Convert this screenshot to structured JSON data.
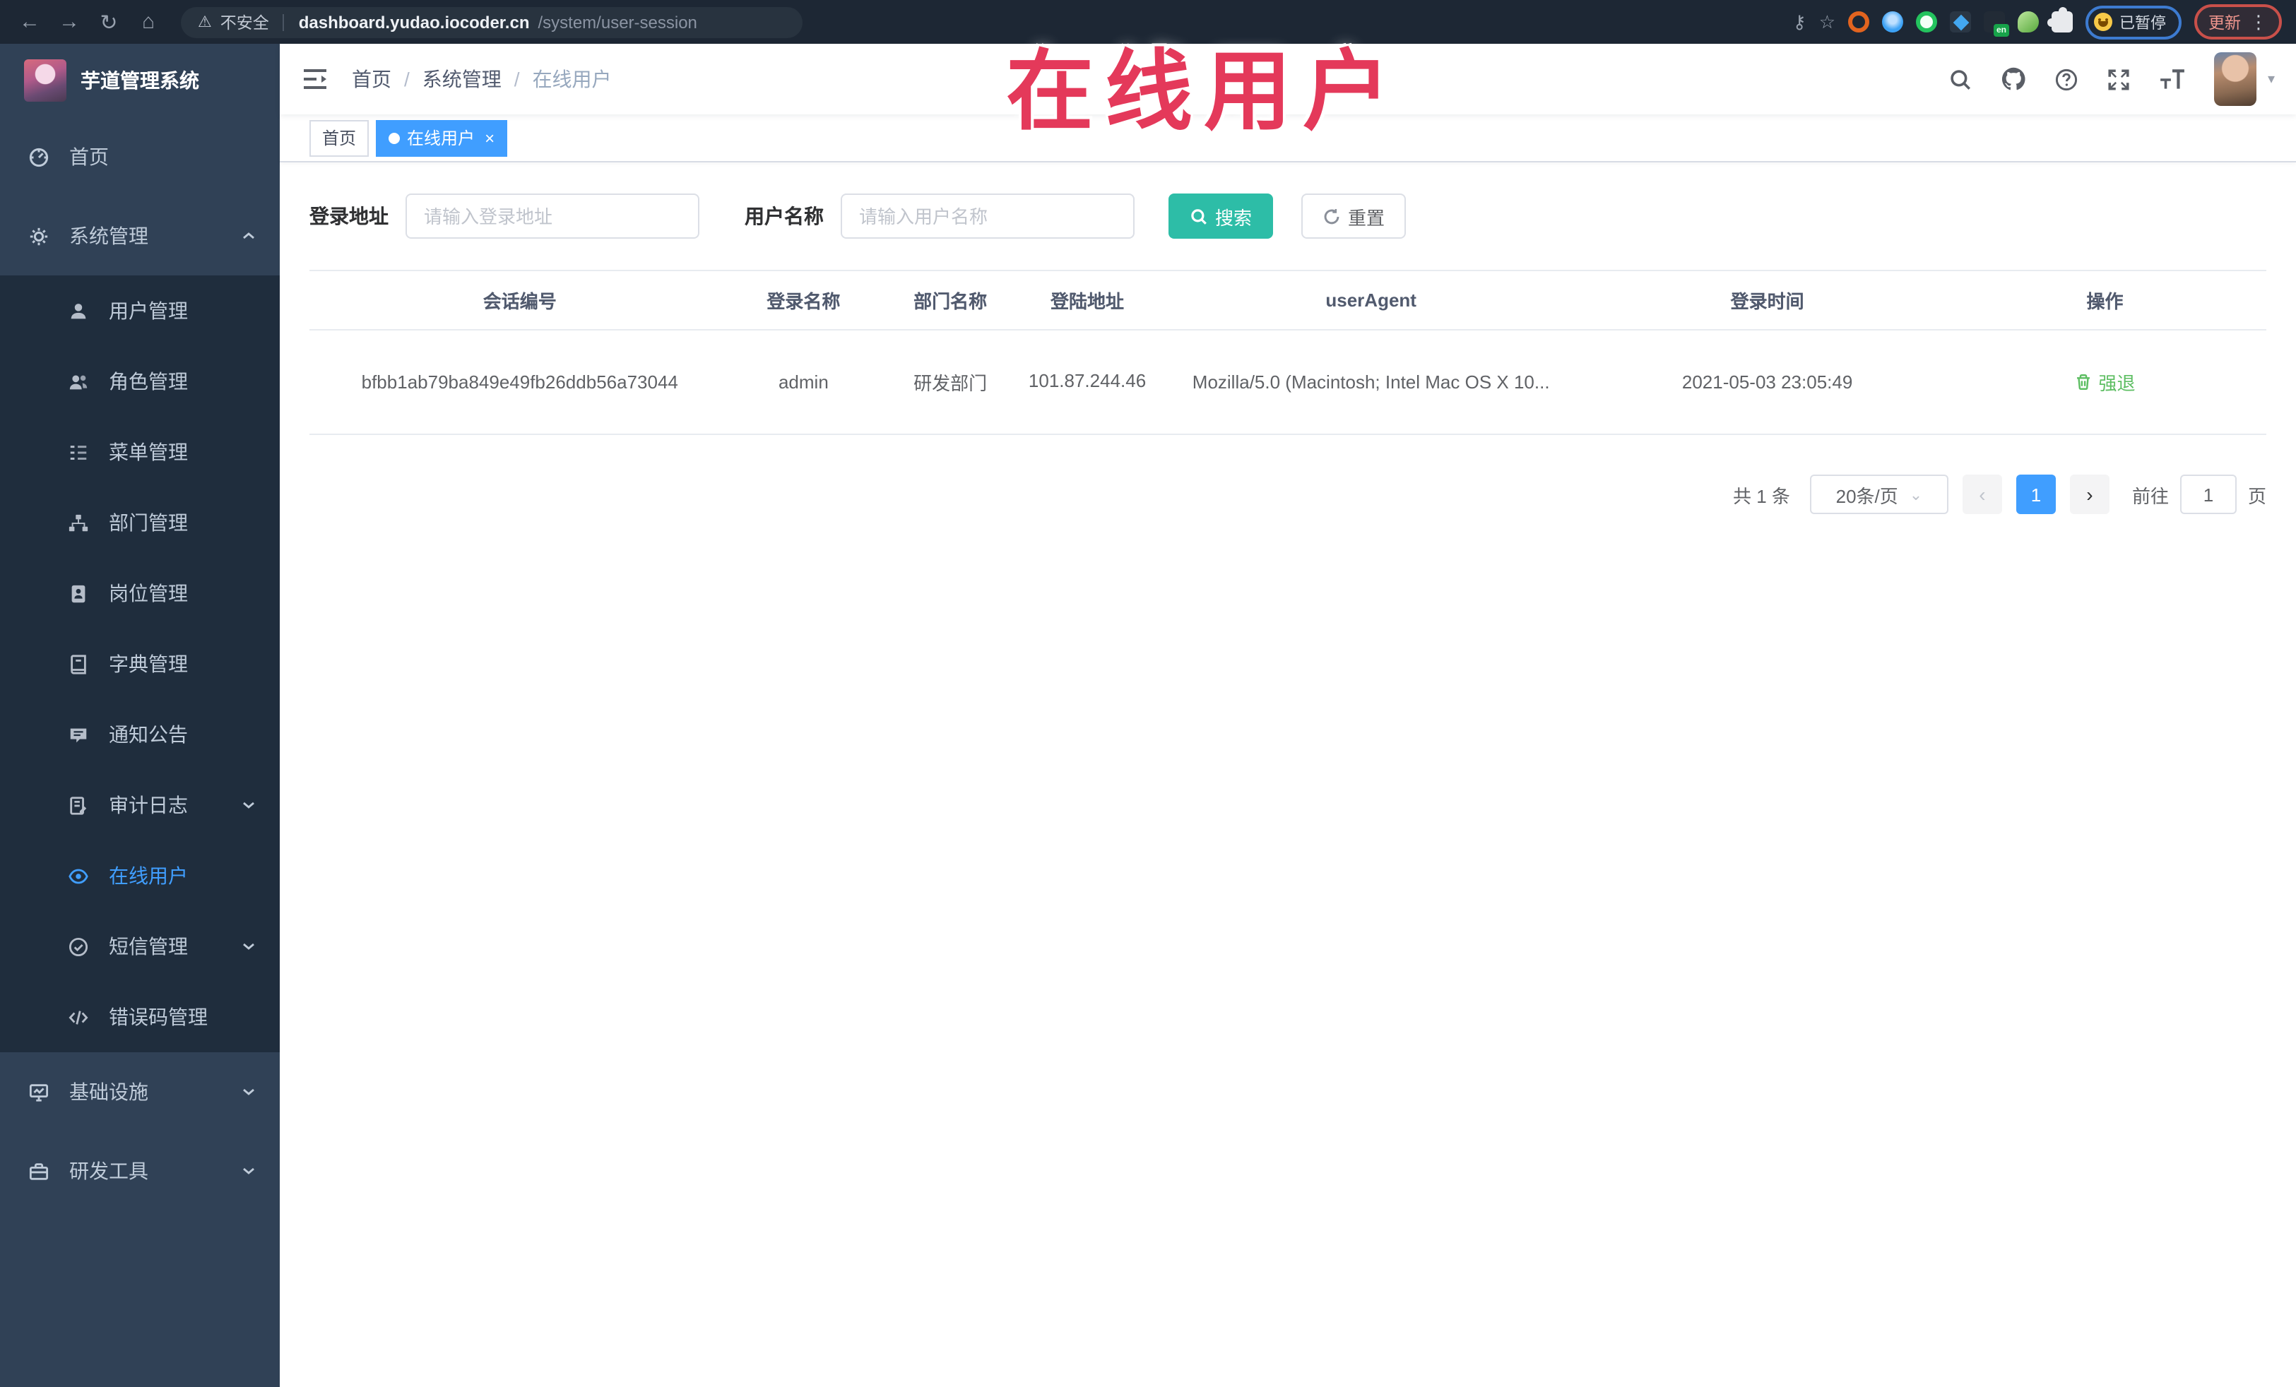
{
  "icons": {
    "back": "←",
    "forward": "→",
    "reload": "↻",
    "home": "⌂",
    "warning": "⚠",
    "key": "⚷",
    "star": "☆",
    "kebab": "⋮",
    "caret_down": "▾",
    "select_caret": "⌄",
    "prev": "‹",
    "next": "›",
    "tab_close": "×"
  },
  "browser": {
    "security_label": "不安全",
    "url_host": "dashboard.yudao.iocoder.cn",
    "url_path": "/system/user-session",
    "en_badge": "en",
    "paused_label": "已暂停",
    "update_label": "更新"
  },
  "watermark": "在线用户",
  "sidebar": {
    "app_title": "芋道管理系统",
    "items": [
      {
        "label": "首页"
      },
      {
        "label": "系统管理"
      },
      {
        "label": "用户管理"
      },
      {
        "label": "角色管理"
      },
      {
        "label": "菜单管理"
      },
      {
        "label": "部门管理"
      },
      {
        "label": "岗位管理"
      },
      {
        "label": "字典管理"
      },
      {
        "label": "通知公告"
      },
      {
        "label": "审计日志"
      },
      {
        "label": "在线用户"
      },
      {
        "label": "短信管理"
      },
      {
        "label": "错误码管理"
      },
      {
        "label": "基础设施"
      },
      {
        "label": "研发工具"
      }
    ]
  },
  "header": {
    "breadcrumb": [
      "首页",
      "系统管理",
      "在线用户"
    ],
    "separator": "/"
  },
  "tabs": [
    {
      "label": "首页"
    },
    {
      "label": "在线用户"
    }
  ],
  "filters": {
    "login_address_label": "登录地址",
    "login_address_placeholder": "请输入登录地址",
    "username_label": "用户名称",
    "username_placeholder": "请输入用户名称",
    "search_label": "搜索",
    "reset_label": "重置"
  },
  "table": {
    "columns": [
      "会话编号",
      "登录名称",
      "部门名称",
      "登陆地址",
      "userAgent",
      "登录时间",
      "操作"
    ],
    "rows": [
      {
        "session_id": "bfbb1ab79ba849e49fb26ddb56a73044",
        "login_name": "admin",
        "dept_name": "研发部门",
        "login_ip": "101.87.244.46",
        "user_agent": "Mozilla/5.0 (Macintosh; Intel Mac OS X 10...",
        "login_time": "2021-05-03 23:05:49",
        "action_label": "强退"
      }
    ]
  },
  "pagination": {
    "total_label": "共 1 条",
    "page_size_label": "20条/页",
    "current_page": "1",
    "goto_label": "前往",
    "goto_value": "1",
    "page_unit_label": "页"
  }
}
